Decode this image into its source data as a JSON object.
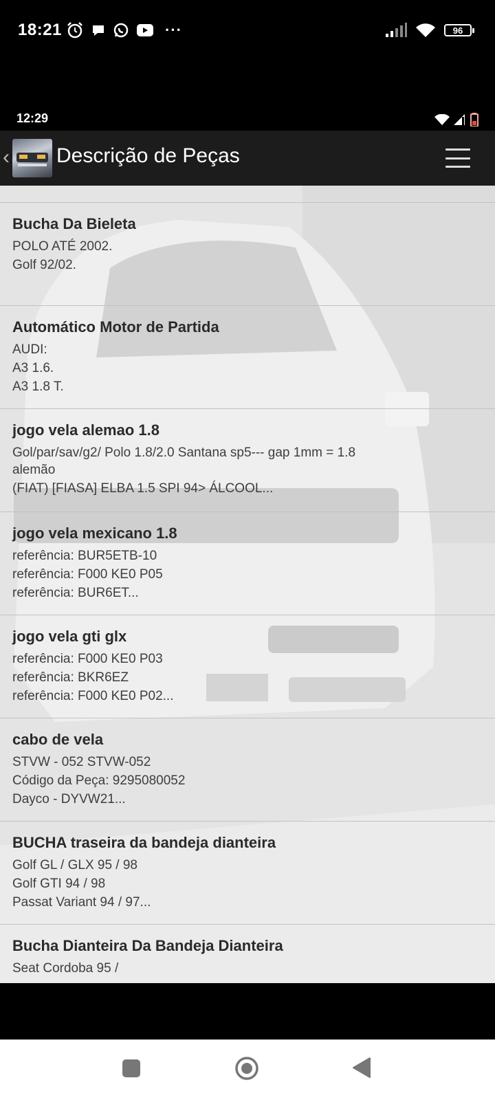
{
  "outer_status": {
    "time": "18:21",
    "battery": "96"
  },
  "inner_status": {
    "time": "12:29"
  },
  "app_bar": {
    "title": "Descrição de Peças"
  },
  "items": [
    {
      "title": "Bucha Da Bieleta",
      "lines": [
        "POLO ATÉ 2002.",
        "Golf 92/02."
      ]
    },
    {
      "title": "Automático Motor de Partida",
      "lines": [
        "AUDI:",
        "A3 1.6.",
        "A3 1.8 T."
      ]
    },
    {
      "title": "jogo vela alemao 1.8",
      "lines": [
        "Gol/par/sav/g2/ Polo 1.8/2.0 Santana sp5--- gap 1mm = 1.8",
        "alemão",
        "(FIAT) [FIASA] ELBA 1.5 SPI 94> ÁLCOOL..."
      ]
    },
    {
      "title": "jogo vela mexicano 1.8",
      "lines": [
        "referência: BUR5ETB-10",
        "referência: F000 KE0 P05",
        "referência: BUR6ET..."
      ]
    },
    {
      "title": "jogo vela gti glx",
      "lines": [
        "referência: F000 KE0 P03",
        "referência: BKR6EZ",
        "referência: F000 KE0 P02..."
      ]
    },
    {
      "title": "cabo de vela",
      "lines": [
        "STVW - 052 STVW-052",
        "Código da Peça: 9295080052",
        "Dayco - DYVW21..."
      ]
    },
    {
      "title": "BUCHA traseira da bandeja dianteira",
      "lines": [
        "Golf GL / GLX 95 / 98",
        "Golf GTI 94 / 98",
        "Passat Variant 94 / 97..."
      ]
    },
    {
      "title": "Bucha Dianteira Da Bandeja Dianteira",
      "lines": [
        "Seat Cordoba 95 /"
      ]
    }
  ]
}
